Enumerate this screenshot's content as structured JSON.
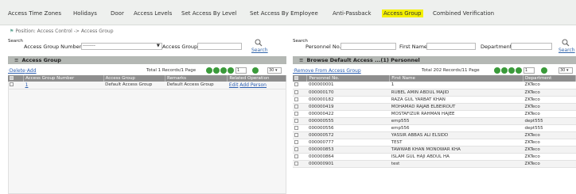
{
  "tabs": [
    {
      "label": "Access Time Zones"
    },
    {
      "label": "Holidays"
    },
    {
      "label": "Door"
    },
    {
      "label": "Access Levels"
    },
    {
      "label": "Set Access By Level"
    },
    {
      "label": "Set Access By Employee"
    },
    {
      "label": "Anti-Passback"
    },
    {
      "label": "Access Group"
    },
    {
      "label": "Combined Verification"
    }
  ],
  "position_text": "Position: Access Control -> Access Group",
  "left": {
    "search_label": "Search",
    "field1_label": "Access Group Number",
    "field1_value": "--------",
    "field2_label": "Access Group",
    "search_link": "Search",
    "title": "Access Group",
    "delete_label": "Delete",
    "add_label": "Add",
    "total_text": "Total 1 Records/1 Page",
    "page_value": "1",
    "per_page": "30",
    "columns": [
      "",
      "Access Group Number",
      "Access Group",
      "Remarks",
      "Related Operation"
    ],
    "rows": [
      {
        "num": "1",
        "group": "Default Access Group",
        "remarks": "Default Access Group",
        "edit": "Edit",
        "add_person": "Add Person"
      }
    ]
  },
  "right": {
    "search_label": "Search",
    "field1_label": "Personnel No.",
    "field2_label": "First Name",
    "field3_label": "Department",
    "search_link": "Search",
    "title": "Browse Default Access ...(1) Personnel",
    "remove_label": "Remove From Access Group",
    "total_text": "Total 202 Records/11 Page",
    "page_value": "1",
    "per_page": "30",
    "columns": [
      "",
      "Personnel No.",
      "First Name",
      "Department"
    ],
    "rows": [
      {
        "no": "000000001",
        "name": "1",
        "dept": "ZKTeco"
      },
      {
        "no": "000000170",
        "name": "RUBEL AMIN ABDUL MAJID",
        "dept": "ZKTeco"
      },
      {
        "no": "000000182",
        "name": "RAZA GUL YARBAT KHAN",
        "dept": "ZKTeco"
      },
      {
        "no": "000000419",
        "name": "MOHAMAD RAJAB ELBEIROUT",
        "dept": "ZKTeco"
      },
      {
        "no": "000000422",
        "name": "MOSTAFIZUR RAHMAN HAJEE",
        "dept": "ZKTeco"
      },
      {
        "no": "000000555",
        "name": "emp555",
        "dept": "dept555"
      },
      {
        "no": "000000556",
        "name": "emp556",
        "dept": "dept555"
      },
      {
        "no": "000000572",
        "name": "YASSIR ABBAS ALI ELSIDD",
        "dept": "ZKTeco"
      },
      {
        "no": "000000777",
        "name": "TEST",
        "dept": "ZKTeco"
      },
      {
        "no": "000000853",
        "name": "TAWWAB KHAN MONOWAR KHA",
        "dept": "ZKTeco"
      },
      {
        "no": "000000864",
        "name": "ISLAM GUL HAJI ABDUL HA",
        "dept": "ZKTeco"
      },
      {
        "no": "000000901",
        "name": "test",
        "dept": "ZKTeco"
      }
    ]
  },
  "colors": {
    "active_tab": "#f4f000",
    "title_bar": "#b4b8b4",
    "header": "#8e8e8e",
    "link": "#2a5db0",
    "pager": "#3a9a3a"
  }
}
